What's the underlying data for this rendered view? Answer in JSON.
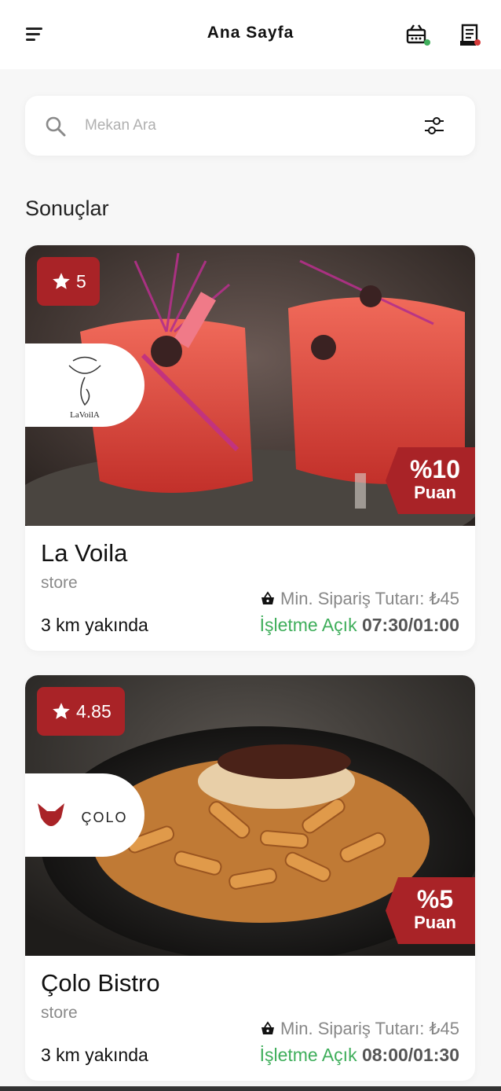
{
  "header": {
    "title": "Ana Sayfa"
  },
  "search": {
    "placeholder": "Mekan Ara"
  },
  "section_title": "Sonuçlar",
  "colors": {
    "accent": "#a92327",
    "open": "#3fae5b",
    "cart_dot": "#3fae5b",
    "orders_dot": "#d63b3b"
  },
  "cards": [
    {
      "rating": "5",
      "name": "La Voila",
      "type": "store",
      "distance": "3 km yakında",
      "points_pct": "%10",
      "points_label": "Puan",
      "min_order": "Min. Sipariş Tutarı: ₺45",
      "status": "İşletme Açık",
      "hours": "07:30/01:00",
      "logo_text": "LaVoilA"
    },
    {
      "rating": "4.85",
      "name": "Çolo Bistro",
      "type": "store",
      "distance": "3 km yakında",
      "points_pct": "%5",
      "points_label": "Puan",
      "min_order": "Min. Sipariş Tutarı: ₺45",
      "status": "İşletme Açık",
      "hours": "08:00/01:30",
      "logo_text": "ÇOLO"
    }
  ]
}
